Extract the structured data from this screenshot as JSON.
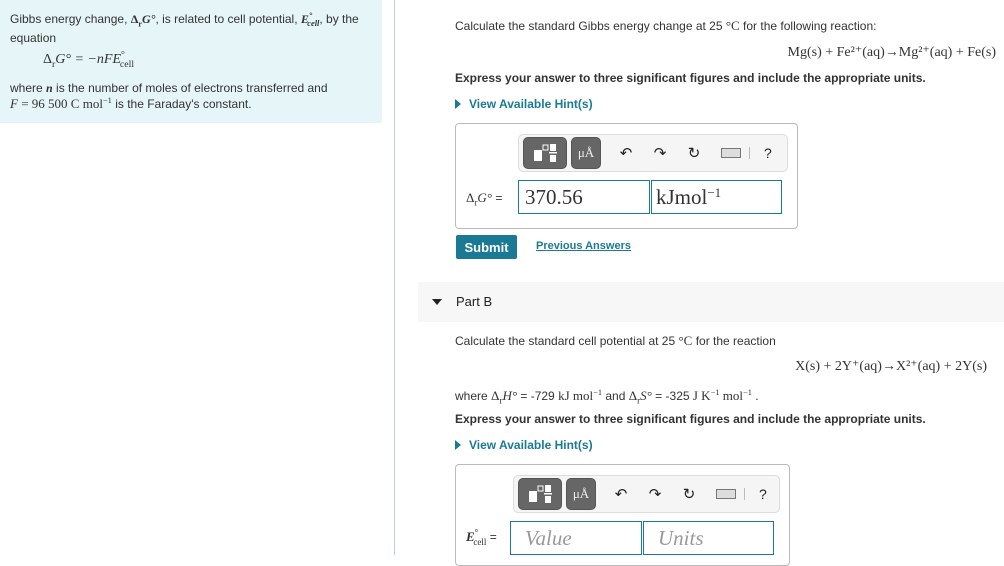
{
  "info": {
    "intro_pre": "Gibbs energy change, ",
    "intro_sym1": "Δ",
    "intro_sym1_sub": "r",
    "intro_sym1_var": "G°",
    "intro_mid": ", is related to cell potential, ",
    "intro_sym2": "E",
    "intro_sym2_sup": "°",
    "intro_sym2_sub": "cell",
    "intro_post": ", by the equation",
    "equation_lhs": "Δ",
    "equation_lhs_sub": "r",
    "equation_lhs_var": "G°",
    "equation_rhs": " = −nFE",
    "equation_rhs_sup": "°",
    "equation_rhs_sub": "cell",
    "where_pre": "where ",
    "where_n": "n",
    "where_post": " is the number of moles of electrons transferred and",
    "faraday_f": "F",
    "faraday_eq": " = 96 500 C mol",
    "faraday_exp": "−1",
    "faraday_post": " is the Faraday's constant."
  },
  "partA": {
    "question_pre": "Calculate the standard Gibbs energy change at 25 ",
    "question_unit": "°C",
    "question_post": " for the following reaction:",
    "reaction": "Mg(s) + Fe²⁺(aq)→Mg²⁺(aq) + Fe(s)",
    "instruction": "Express your answer to three significant figures and include the appropriate units.",
    "hint_label": "View Available Hint(s)",
    "answer_label_pre": "Δ",
    "answer_label_sub": "r",
    "answer_label_var": "G°",
    "answer_label_eq": " =",
    "value": "370.56",
    "units": "kJmol",
    "units_exp": "−1",
    "submit_label": "Submit",
    "previous_answers_label": "Previous Answers"
  },
  "partB": {
    "title": "Part B",
    "question_pre": "Calculate the standard cell potential at 25 ",
    "question_unit": "°C",
    "question_post": " for the reaction",
    "reaction": "X(s) + 2Y⁺(aq)→X²⁺(aq) + 2Y(s)",
    "where_pre": "where ",
    "dh_sym": "Δ",
    "dh_sub": "r",
    "dh_var": "H°",
    "dh_val": " = -729 ",
    "dh_unit": "kJ mol",
    "dh_exp": "−1",
    "and": " and ",
    "ds_sym": "Δ",
    "ds_sub": "r",
    "ds_var": "S°",
    "ds_val": " = -325 ",
    "ds_unit1": "J K",
    "ds_exp1": "−1",
    "ds_unit2": " mol",
    "ds_exp2": "−1",
    "period": " .",
    "instruction": "Express your answer to three significant figures and include the appropriate units.",
    "hint_label": "View Available Hint(s)",
    "answer_label_var": "E",
    "answer_label_sup": "°",
    "answer_label_sub": "cell",
    "answer_label_eq": " =",
    "value_placeholder": "Value",
    "units_placeholder": "Units"
  },
  "toolbar": {
    "units_button": "μÅ",
    "undo_icon": "↶",
    "redo_icon": "↷",
    "reset_icon": "↻",
    "help_label": "?"
  },
  "colors": {
    "accent": "#1a7a96",
    "info_bg": "#e6f5f7",
    "part_header_bg": "#f7f7f7"
  }
}
